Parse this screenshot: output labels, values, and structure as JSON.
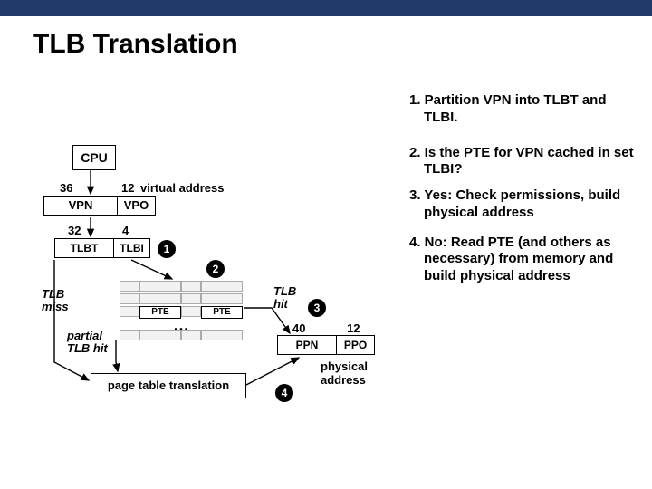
{
  "title": "TLB Translation",
  "cpu": "CPU",
  "va": {
    "bits_vpn": "36",
    "bits_vpo": "12",
    "vpn": "VPN",
    "vpo": "VPO",
    "label": "virtual address"
  },
  "tlb_split": {
    "bits_tlbt": "32",
    "bits_tlbi": "4",
    "tlbt": "TLBT",
    "tlbi": "TLBI"
  },
  "tlb_miss": "TLB\nmiss",
  "tlb_hit": "TLB\nhit",
  "partial": "partial\nTLB hit",
  "pte": "PTE",
  "dots": "…",
  "pt_trans": "page table translation",
  "pa": {
    "bits_ppn": "40",
    "bits_ppo": "12",
    "ppn": "PPN",
    "ppo": "PPO",
    "label": "physical\naddress"
  },
  "circles": {
    "c1": "1",
    "c2": "2",
    "c3": "3",
    "c4": "4"
  },
  "steps": {
    "s1": "1. Partition VPN into TLBT and TLBI.",
    "s2": "2. Is the PTE for VPN cached in set TLBI?",
    "s3a": "3. Yes: ",
    "s3b": "Check permissions, build physical address",
    "s4a": "4. No: ",
    "s4b": "Read PTE (and others as necessary) from memory and build physical address"
  }
}
